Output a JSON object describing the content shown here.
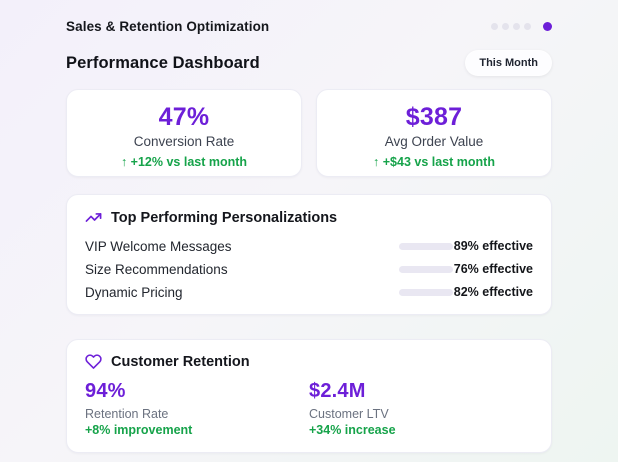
{
  "header": {
    "app_title": "Sales & Retention Optimization",
    "heading": "Performance Dashboard",
    "period_badge": "This Month",
    "progress_dots": {
      "inactive_count": 4,
      "active_index": 4
    }
  },
  "stat_cards": [
    {
      "value": "47%",
      "label": "Conversion Rate",
      "delta": "↑ +12% vs last month"
    },
    {
      "value": "$387",
      "label": "Avg Order Value",
      "delta": "↑ +$43 vs last month"
    }
  ],
  "personalizations": {
    "icon": "trending-up-icon",
    "title": "Top Performing Personalizations",
    "rows": [
      {
        "label": "VIP Welcome Messages",
        "percent": 89,
        "effect": "89% effective"
      },
      {
        "label": "Size Recommendations",
        "percent": 76,
        "effect": "76% effective"
      },
      {
        "label": "Dynamic Pricing",
        "percent": 82,
        "effect": "82% effective"
      }
    ]
  },
  "retention": {
    "icon": "heart-icon",
    "title": "Customer Retention",
    "stats": [
      {
        "value": "94%",
        "label": "Retention Rate",
        "delta": "+8% improvement"
      },
      {
        "value": "$2.4M",
        "label": "Customer LTV",
        "delta": "+34% increase"
      }
    ]
  },
  "colors": {
    "accent": "#6d1fd8",
    "positive": "#16a34a",
    "track": "#e9e7f2"
  }
}
